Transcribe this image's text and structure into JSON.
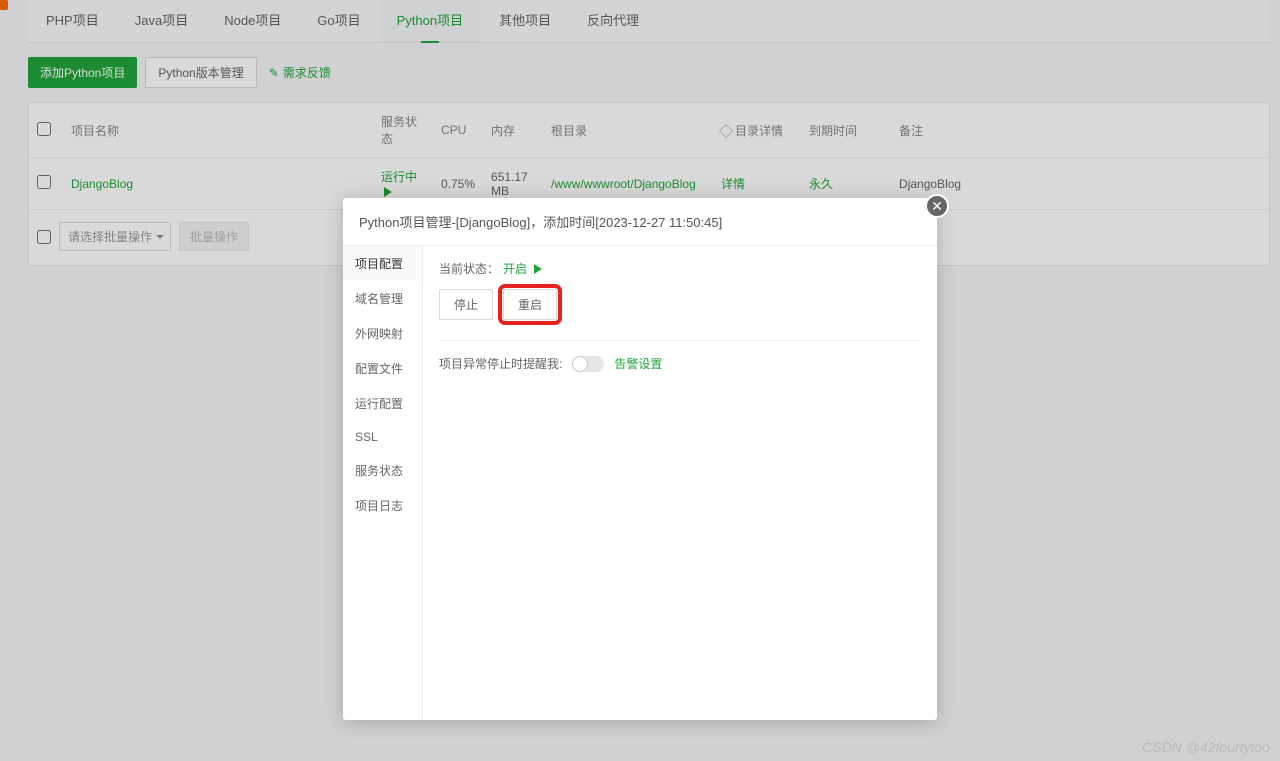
{
  "tabs": {
    "php": "PHP项目",
    "java": "Java项目",
    "node": "Node项目",
    "go": "Go项目",
    "python": "Python项目",
    "other": "其他项目",
    "proxy": "反向代理"
  },
  "toolbar": {
    "add": "添加Python项目",
    "version": "Python版本管理",
    "feedback": "需求反馈"
  },
  "table": {
    "headers": {
      "name": "项目名称",
      "status": "服务状态",
      "cpu": "CPU",
      "mem": "内存",
      "root": "根目录",
      "detail": "目录详情",
      "expire": "到期时间",
      "remark": "备注"
    },
    "row": {
      "name": "DjangoBlog",
      "status": "运行中",
      "cpu": "0.75%",
      "mem": "651.17 MB",
      "root": "/www/wwwroot/DjangoBlog",
      "detail": "详情",
      "expire": "永久",
      "remark": "DjangoBlog"
    }
  },
  "bulk": {
    "select": "请选择批量操作",
    "apply": "批量操作"
  },
  "modal": {
    "title": "Python项目管理-[DjangoBlog]，添加时间[2023-12-27 11:50:45]",
    "nav": {
      "config": "项目配置",
      "domain": "域名管理",
      "wan": "外网映射",
      "conf_file": "配置文件",
      "run": "运行配置",
      "ssl": "SSL",
      "svc": "服务状态",
      "log": "项目日志"
    },
    "status_label": "当前状态：",
    "status_value": "开启",
    "stop": "停止",
    "restart": "重启",
    "remind_label": "项目异常停止时提醒我:",
    "alarm": "告警设置"
  },
  "watermark": "CSDN @42fourtytoo"
}
